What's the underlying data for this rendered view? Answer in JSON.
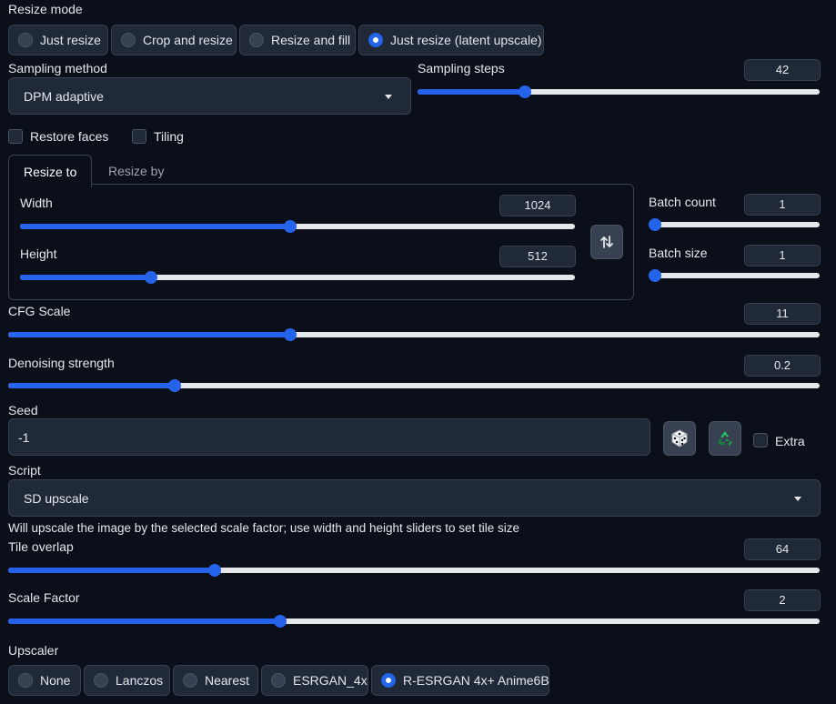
{
  "resize_mode": {
    "label": "Resize mode",
    "options": [
      "Just resize",
      "Crop and resize",
      "Resize and fill",
      "Just resize (latent upscale)"
    ],
    "selected": "Just resize (latent upscale)"
  },
  "sampling_method": {
    "label": "Sampling method",
    "value": "DPM adaptive"
  },
  "sampling_steps": {
    "label": "Sampling steps",
    "value": "42",
    "fraction": 0.26
  },
  "restore_faces": {
    "label": "Restore faces",
    "checked": false
  },
  "tiling": {
    "label": "Tiling",
    "checked": false
  },
  "size_tabs": {
    "active": "Resize to",
    "inactive": "Resize by"
  },
  "width": {
    "label": "Width",
    "value": "1024",
    "fraction": 0.486
  },
  "height": {
    "label": "Height",
    "value": "512",
    "fraction": 0.23
  },
  "batch_count": {
    "label": "Batch count",
    "value": "1",
    "fraction": 0.0
  },
  "batch_size": {
    "label": "Batch size",
    "value": "1",
    "fraction": 0.0
  },
  "cfg_scale": {
    "label": "CFG Scale",
    "value": "11",
    "fraction": 0.345
  },
  "denoising_strength": {
    "label": "Denoising strength",
    "value": "0.2",
    "fraction": 0.2
  },
  "seed": {
    "label": "Seed",
    "value": "-1",
    "extra_label": "Extra"
  },
  "script": {
    "label": "Script",
    "value": "SD upscale",
    "description": "Will upscale the image by the selected scale factor; use width and height sliders to set tile size"
  },
  "tile_overlap": {
    "label": "Tile overlap",
    "value": "64",
    "fraction": 0.25
  },
  "scale_factor": {
    "label": "Scale Factor",
    "value": "2",
    "fraction": 0.333
  },
  "upscaler": {
    "label": "Upscaler",
    "options": [
      "None",
      "Lanczos",
      "Nearest",
      "ESRGAN_4x",
      "R-ESRGAN 4x+ Anime6B"
    ],
    "selected": "R-ESRGAN 4x+ Anime6B"
  },
  "colors": {
    "accent": "#2563eb",
    "background": "#0b0f19",
    "panel": "#1f2937",
    "border": "#374151"
  }
}
